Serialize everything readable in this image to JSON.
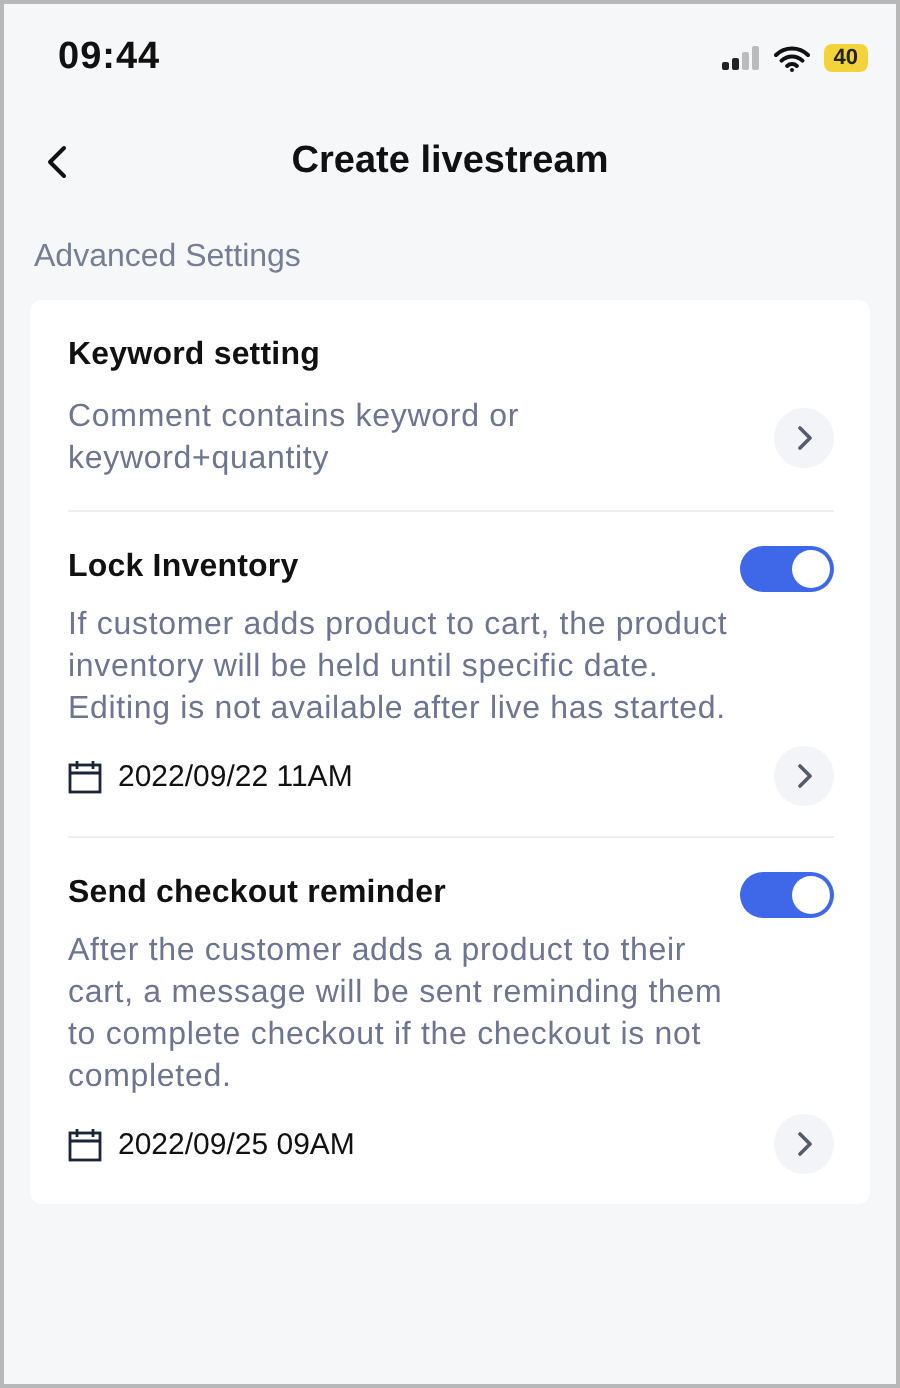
{
  "status_bar": {
    "time": "09:44",
    "battery": "40"
  },
  "header": {
    "title": "Create livestream"
  },
  "section": {
    "title": "Advanced Settings"
  },
  "settings": [
    {
      "kind": "link",
      "title": "Keyword setting",
      "description": "Comment contains keyword or keyword+quantity"
    },
    {
      "kind": "toggle",
      "title": "Lock Inventory",
      "on": true,
      "description": "If customer adds product to cart, the product inventory will be held until specific date. Editing is not available after live has started.",
      "date": "2022/09/22 11AM"
    },
    {
      "kind": "toggle",
      "title": "Send checkout reminder",
      "on": true,
      "description": "After the customer adds a product to their cart, a message will be sent reminding them to complete checkout if the checkout is not completed.",
      "date": "2022/09/25 09AM"
    }
  ]
}
